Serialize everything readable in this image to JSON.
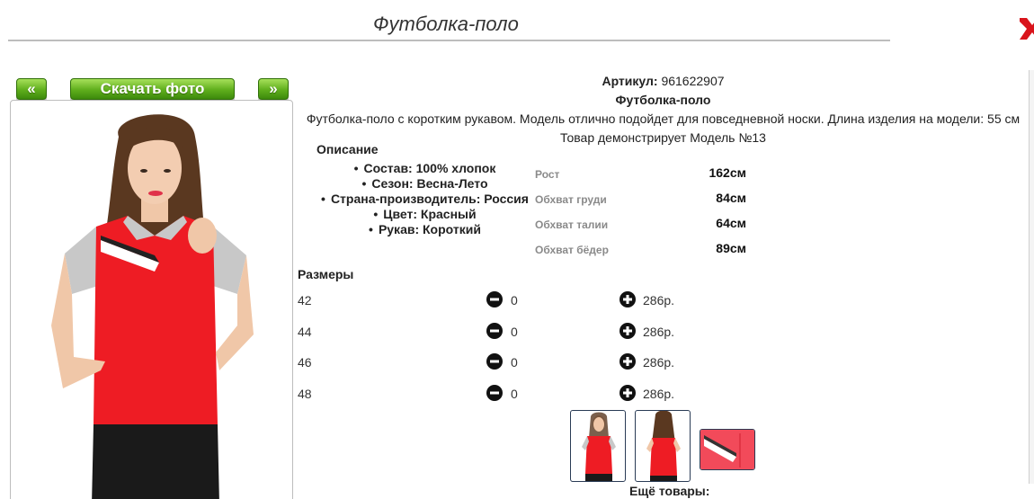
{
  "header": {
    "title": "Футболка-поло"
  },
  "nav": {
    "prev_label": "«",
    "download_label": "Скачать фото",
    "next_label": "»"
  },
  "product": {
    "article_label": "Артикул:",
    "article_value": "961622907",
    "name": "Футболка-поло",
    "summary": "Футболка-поло с коротким рукавом. Модель отлично подойдет для повседневной носки. Длина изделия на модели: 55 см",
    "model_note": "Товар демонстрирует Модель №13"
  },
  "description": {
    "heading": "Описание",
    "items": [
      "Состав: 100% хлопок",
      "Сезон: Весна-Лето",
      "Страна-производитель: Россия",
      "Цвет: Красный",
      "Рукав: Короткий"
    ]
  },
  "measurements": [
    {
      "label": "Рост",
      "value": "162см"
    },
    {
      "label": "Обхват груди",
      "value": "84см"
    },
    {
      "label": "Обхват талии",
      "value": "64см"
    },
    {
      "label": "Обхват бёдер",
      "value": "89см"
    }
  ],
  "sizes": {
    "heading": "Размеры",
    "rows": [
      {
        "size": "42",
        "qty": "0",
        "price": "286р."
      },
      {
        "size": "44",
        "qty": "0",
        "price": "286р."
      },
      {
        "size": "46",
        "qty": "0",
        "price": "286р."
      },
      {
        "size": "48",
        "qty": "0",
        "price": "286р."
      }
    ]
  },
  "more": {
    "label": "Ещё товары:"
  },
  "colors": {
    "accent_green": "#5fae1c",
    "shirt_red": "#ee1c24",
    "close_red": "#d9141b"
  },
  "icons": {
    "close": "close-x-icon",
    "minus": "minus-circle-icon",
    "plus": "plus-circle-icon"
  }
}
